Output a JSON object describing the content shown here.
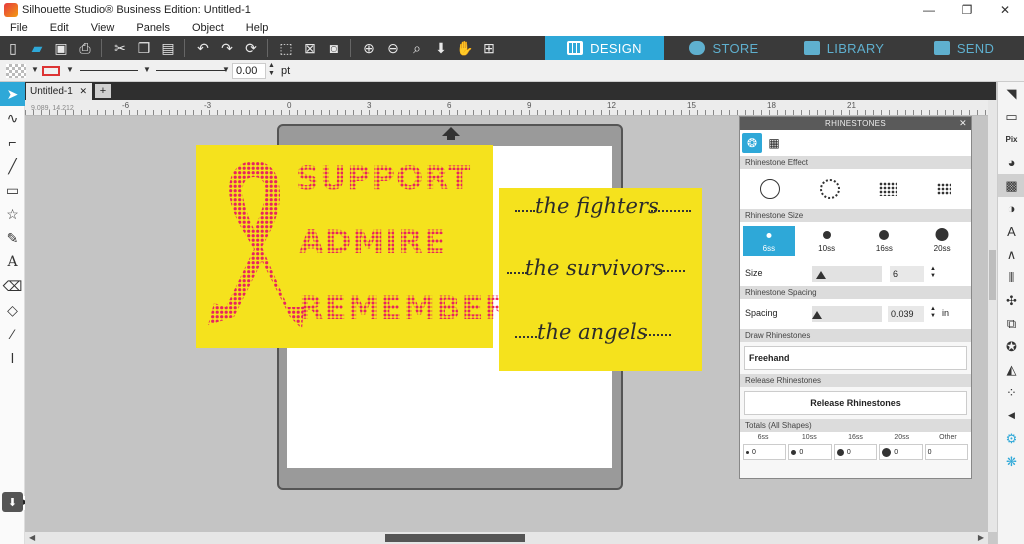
{
  "window": {
    "title": "Silhouette Studio® Business Edition: Untitled-1",
    "minimize": "—",
    "restore": "❐",
    "close": "✕"
  },
  "menu": [
    "File",
    "Edit",
    "View",
    "Panels",
    "Object",
    "Help"
  ],
  "nav_tabs": {
    "design": "DESIGN",
    "store": "STORE",
    "library": "LIBRARY",
    "send": "SEND"
  },
  "properties": {
    "line_width": "0.00",
    "unit": "pt"
  },
  "document_tab": {
    "label": "Untitled-1",
    "close": "✕",
    "add": "+"
  },
  "ruler": {
    "labels": [
      "-6",
      "-3",
      "0",
      "3",
      "6",
      "9",
      "12",
      "15",
      "18",
      "21"
    ],
    "coords": "9.089, 14.212"
  },
  "artwork": {
    "words": [
      "SUPPORT",
      "ADMIRE",
      "REMEMBER"
    ],
    "phrases": [
      "the fighters",
      "the survivors",
      "the angels"
    ]
  },
  "panel": {
    "title": "RHINESTONES",
    "close": "✕",
    "effect_header": "Rhinestone Effect",
    "size_header": "Rhinestone Size",
    "sizes": [
      "6ss",
      "10ss",
      "16ss",
      "20ss"
    ],
    "size_label": "Size",
    "size_value": "6",
    "spacing_header": "Rhinestone Spacing",
    "spacing_label": "Spacing",
    "spacing_value": "0.039",
    "spacing_unit": "in",
    "draw_header": "Draw Rhinestones",
    "draw_button": "Freehand",
    "release_header": "Release Rhinestones",
    "release_button": "Release Rhinestones",
    "totals_header": "Totals (All Shapes)",
    "totals_columns": [
      "6ss",
      "10ss",
      "16ss",
      "20ss",
      "Other"
    ],
    "totals_values": [
      "0",
      "0",
      "0",
      "0",
      "0"
    ]
  },
  "colors": {
    "accent": "#2ea8d8",
    "toolbar": "#3a3a3a",
    "artwork_background": "#f5e21d",
    "rhinestone_pink": "#e8245f"
  }
}
